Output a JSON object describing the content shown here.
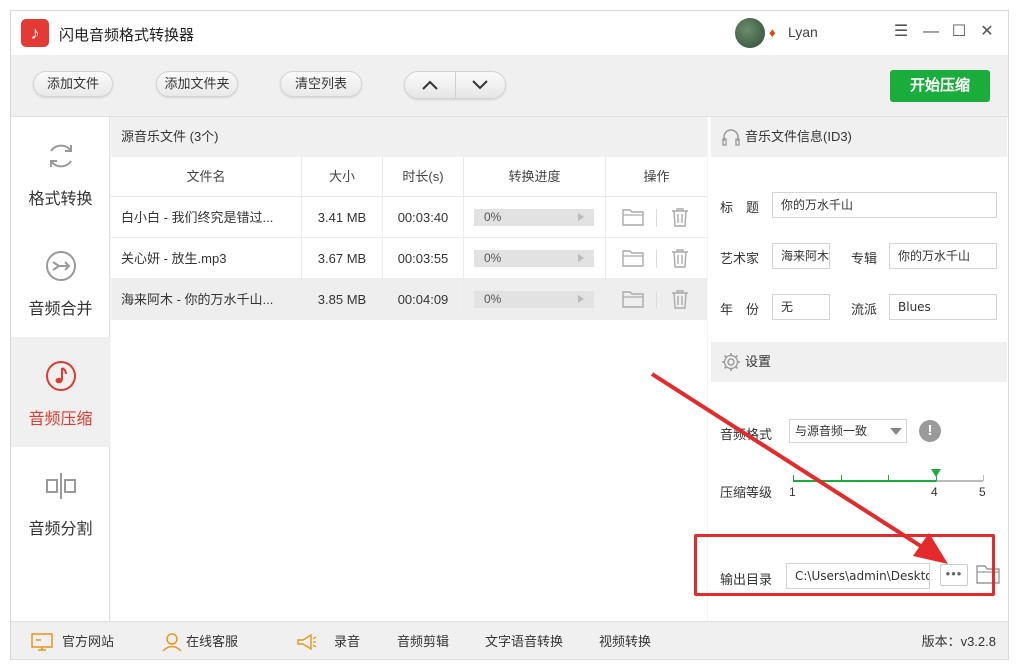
{
  "app": {
    "title": "闪电音频格式转换器",
    "user_name": "Lyan",
    "accent_color": "#1aad3b",
    "brand_color": "#e53935"
  },
  "toolbar": {
    "add_file": "添加文件",
    "add_folder": "添加文件夹",
    "clear_list": "清空列表",
    "start_label": "开始压缩"
  },
  "sidebar": {
    "items": [
      {
        "label": "格式转换",
        "icon": "refresh-icon"
      },
      {
        "label": "音频合并",
        "icon": "merge-icon"
      },
      {
        "label": "音频压缩",
        "icon": "music-note-icon",
        "active": true
      },
      {
        "label": "音频分割",
        "icon": "split-icon"
      }
    ]
  },
  "filelist": {
    "header": "源音乐文件 (3个)",
    "columns": [
      "文件名",
      "大小",
      "时长(s)",
      "转换进度",
      "操作"
    ],
    "rows": [
      {
        "name": "白小白 - 我们终究是错过...",
        "size": "3.41 MB",
        "duration": "00:03:40",
        "progress": "0%"
      },
      {
        "name": "关心妍 - 放生.mp3",
        "size": "3.67 MB",
        "duration": "00:03:55",
        "progress": "0%"
      },
      {
        "name": "海来阿木 - 你的万水千山...",
        "size": "3.85 MB",
        "duration": "00:04:09",
        "progress": "0%"
      }
    ]
  },
  "id3": {
    "header": "音乐文件信息(ID3)",
    "title_label": "标　题",
    "title_value": "你的万水千山",
    "artist_label": "艺术家",
    "artist_value": "海来阿木",
    "album_label": "专辑",
    "album_value": "你的万水千山",
    "year_label": "年　份",
    "year_value": "无",
    "genre_label": "流派",
    "genre_value": "Blues"
  },
  "settings": {
    "header": "设置",
    "format_label": "音频格式",
    "format_value": "与源音频一致",
    "level_label": "压缩等级",
    "level_ticks": [
      "1",
      "4",
      "5"
    ],
    "level_value": 4,
    "level_max": 5,
    "output_label": "输出目录",
    "output_value": "C:\\Users\\admin\\Desktop",
    "more_label": "•••"
  },
  "bottom": {
    "website": "官方网站",
    "support": "在线客服",
    "record": "录音",
    "edit": "音频剪辑",
    "tts": "文字语音转换",
    "video": "视频转换",
    "version": "版本：v3.2.8"
  }
}
